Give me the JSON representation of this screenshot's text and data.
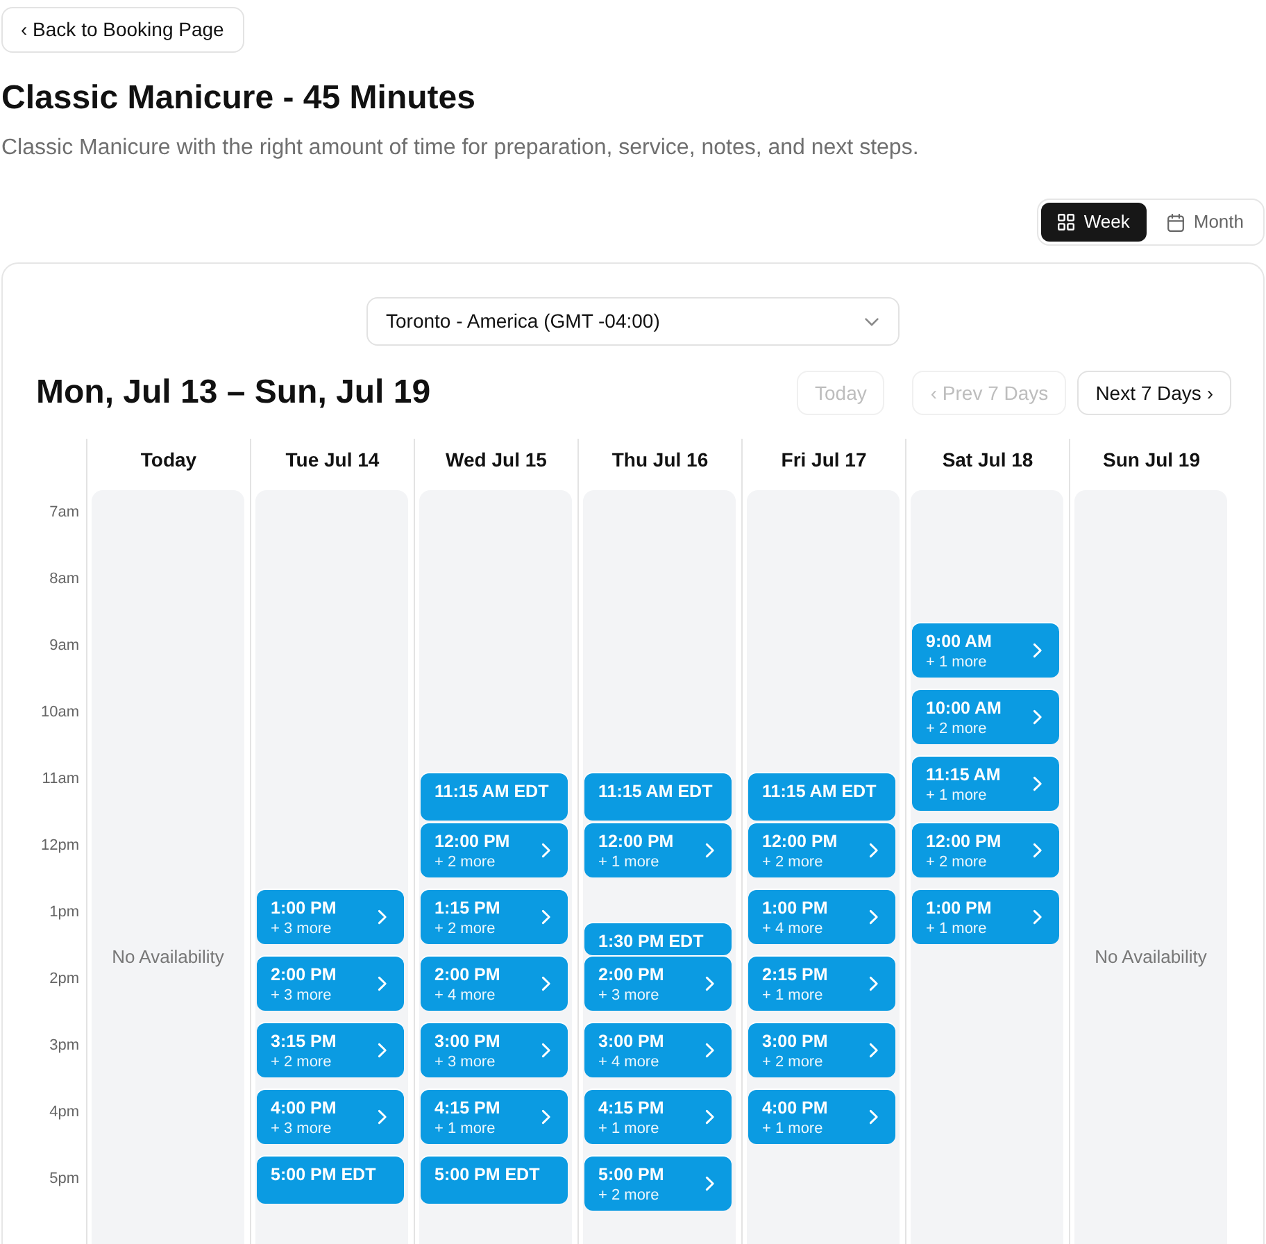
{
  "back_button": {
    "label": "‹ Back to Booking Page"
  },
  "title": "Classic Manicure - 45 Minutes",
  "description": "Classic Manicure with the right amount of time for preparation, service, notes, and next steps.",
  "view_toggle": [
    {
      "label": "Week",
      "kind": "grid",
      "selected": true
    },
    {
      "label": "Month",
      "kind": "calendar",
      "selected": false
    }
  ],
  "timezone": {
    "value": "Toronto - America (GMT -04:00)"
  },
  "range_title": "Mon, Jul 13 – Sun, Jul 19",
  "today_button": {
    "label": "Today",
    "disabled": true
  },
  "pager": [
    {
      "label": "‹ Prev 7 Days",
      "disabled": true
    },
    {
      "label": "Next 7 Days ›",
      "disabled": false
    }
  ],
  "hours": [
    "7am",
    "8am",
    "9am",
    "10am",
    "11am",
    "12pm",
    "1pm",
    "2pm",
    "3pm",
    "4pm",
    "5pm"
  ],
  "days": [
    {
      "label": "Today",
      "note": "No Availability"
    },
    {
      "label": "Tue Jul 14",
      "slots": [
        {
          "kind": "group",
          "time": "1:00 PM",
          "more": "+ 3 more"
        },
        {
          "kind": "group",
          "time": "2:00 PM",
          "more": "+ 3 more"
        },
        {
          "kind": "group",
          "time": "3:15 PM",
          "more": "+ 2 more"
        },
        {
          "kind": "group",
          "time": "4:00 PM",
          "more": "+ 3 more"
        },
        {
          "kind": "single",
          "time": "5:00 PM EDT"
        }
      ]
    },
    {
      "label": "Wed Jul 15",
      "slots": [
        {
          "kind": "single",
          "time": "11:15 AM EDT"
        },
        {
          "kind": "group",
          "time": "12:00 PM",
          "more": "+ 2 more"
        },
        {
          "kind": "group",
          "time": "1:15 PM",
          "more": "+ 2 more"
        },
        {
          "kind": "group",
          "time": "2:00 PM",
          "more": "+ 4 more"
        },
        {
          "kind": "group",
          "time": "3:00 PM",
          "more": "+ 3 more"
        },
        {
          "kind": "group",
          "time": "4:15 PM",
          "more": "+ 1 more"
        },
        {
          "kind": "single",
          "time": "5:00 PM EDT"
        }
      ]
    },
    {
      "label": "Thu Jul 16",
      "slots": [
        {
          "kind": "single",
          "time": "11:15 AM EDT"
        },
        {
          "kind": "group",
          "time": "12:00 PM",
          "more": "+ 1 more"
        },
        {
          "kind": "single",
          "time": "1:30 PM EDT"
        },
        {
          "kind": "group",
          "time": "2:00 PM",
          "more": "+ 3 more"
        },
        {
          "kind": "group",
          "time": "3:00 PM",
          "more": "+ 4 more"
        },
        {
          "kind": "group",
          "time": "4:15 PM",
          "more": "+ 1 more"
        },
        {
          "kind": "group",
          "time": "5:00 PM",
          "more": "+ 2 more"
        }
      ]
    },
    {
      "label": "Fri Jul 17",
      "slots": [
        {
          "kind": "single",
          "time": "11:15 AM EDT"
        },
        {
          "kind": "group",
          "time": "12:00 PM",
          "more": "+ 2 more"
        },
        {
          "kind": "group",
          "time": "1:00 PM",
          "more": "+ 4 more"
        },
        {
          "kind": "group",
          "time": "2:15 PM",
          "more": "+ 1 more"
        },
        {
          "kind": "group",
          "time": "3:00 PM",
          "more": "+ 2 more"
        },
        {
          "kind": "group",
          "time": "4:00 PM",
          "more": "+ 1 more"
        }
      ]
    },
    {
      "label": "Sat Jul 18",
      "slots": [
        {
          "kind": "group",
          "time": "9:00 AM",
          "more": "+ 1 more"
        },
        {
          "kind": "group",
          "time": "10:00 AM",
          "more": "+ 2 more"
        },
        {
          "kind": "group",
          "time": "11:15 AM",
          "more": "+ 1 more"
        },
        {
          "kind": "group",
          "time": "12:00 PM",
          "more": "+ 2 more"
        },
        {
          "kind": "group",
          "time": "1:00 PM",
          "more": "+ 1 more"
        }
      ]
    },
    {
      "label": "Sun Jul 19",
      "note": "No Availability"
    }
  ]
}
